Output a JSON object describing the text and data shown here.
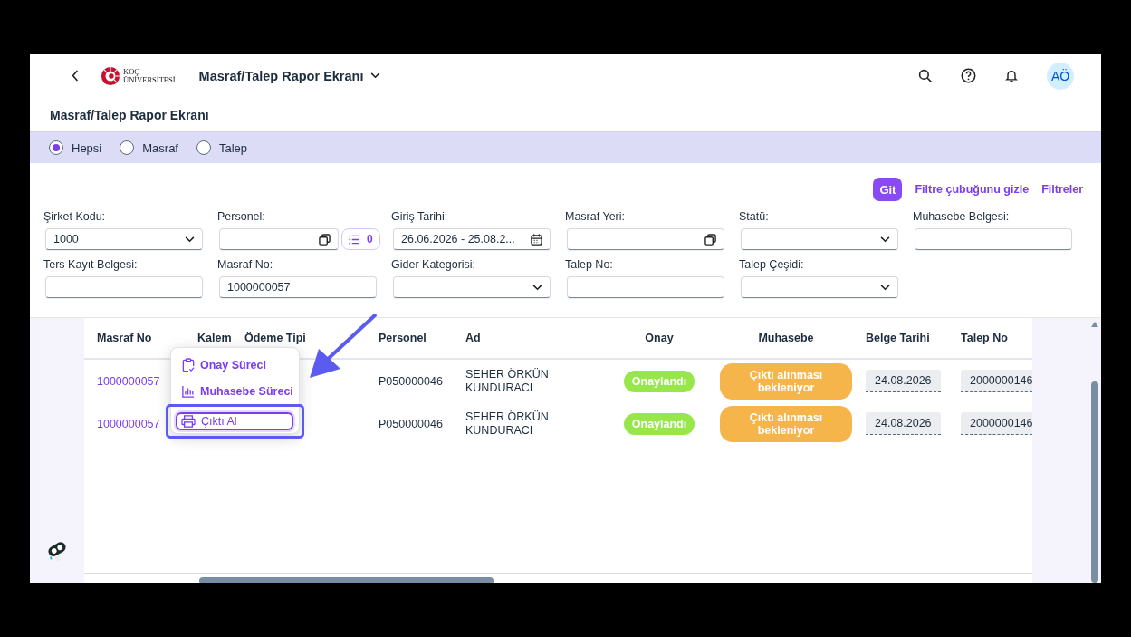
{
  "header": {
    "logo_line_1": "KOÇ",
    "logo_line_2": "ÜNİVERSİTESİ",
    "title": "Masraf/Talep Rapor Ekranı",
    "avatar": "AÖ"
  },
  "page_title": "Masraf/Talep Rapor Ekranı",
  "radios": [
    {
      "label": "Hepsi",
      "selected": true
    },
    {
      "label": "Masraf",
      "selected": false
    },
    {
      "label": "Talep",
      "selected": false
    }
  ],
  "filter_actions": {
    "go": "Git",
    "hide": "Filtre çubuğunu gizle",
    "filters": "Filtreler"
  },
  "fields": [
    {
      "label": "Şirket Kodu:",
      "kind": "select",
      "value": "1000"
    },
    {
      "label": "Personel:",
      "kind": "valuehelp",
      "token_count": "0"
    },
    {
      "label": "Giriş Tarihi:",
      "kind": "date",
      "value": "26.06.2026 - 25.08.2..."
    },
    {
      "label": "Masraf Yeri:",
      "kind": "valuehelp"
    },
    {
      "label": "Statü:",
      "kind": "select"
    },
    {
      "label": "Muhasebe Belgesi:",
      "kind": "text"
    },
    {
      "label": "Ters Kayıt Belgesi:",
      "kind": "text"
    },
    {
      "label": "Masraf No:",
      "kind": "text",
      "value": "1000000057"
    },
    {
      "label": "Gider Kategorisi:",
      "kind": "select"
    },
    {
      "label": "Talep No:",
      "kind": "text"
    },
    {
      "label": "Talep Çeşidi:",
      "kind": "select"
    }
  ],
  "table": {
    "columns": [
      "Masraf No",
      "Kalem",
      "Ödeme Tipi",
      "Personel",
      "Ad",
      "Onay",
      "Muhasebe",
      "Belge Tarihi",
      "Talep No"
    ],
    "rows": [
      {
        "masraf_no": "1000000057",
        "personel": "P050000046",
        "ad": "SEHER ÖRKÜN KUNDURACI",
        "onay": "Onaylandı",
        "muhasebe": "Çıktı alınması bekleniyor",
        "belge_tarihi": "24.08.2026",
        "talep_no": "2000000146"
      },
      {
        "masraf_no": "1000000057",
        "personel": "P050000046",
        "ad": "SEHER ÖRKÜN KUNDURACI",
        "onay": "Onaylandı",
        "muhasebe": "Çıktı alınması bekleniyor",
        "belge_tarihi": "24.08.2026",
        "talep_no": "2000000146"
      }
    ]
  },
  "menu": [
    {
      "label": "Onay Süreci",
      "kind": "clipboard",
      "highlighted": false
    },
    {
      "label": "Muhasebe Süreci",
      "kind": "chart",
      "highlighted": false
    },
    {
      "label": "Çıktı Al",
      "kind": "printer",
      "highlighted": true
    }
  ]
}
